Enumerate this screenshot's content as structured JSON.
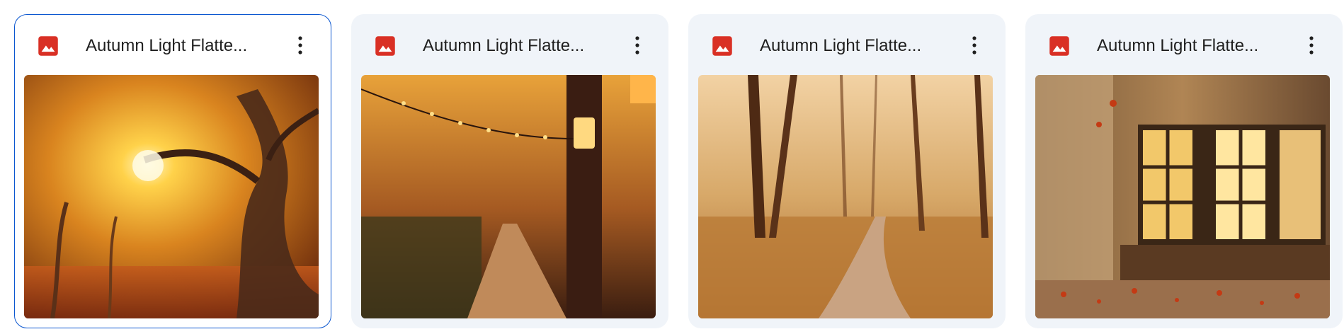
{
  "files": [
    {
      "title": "Autumn Light Flatte...",
      "icon": "image-file-icon",
      "more_icon": "more-vert-icon",
      "selected": true
    },
    {
      "title": "Autumn Light Flatte...",
      "icon": "image-file-icon",
      "more_icon": "more-vert-icon",
      "selected": false
    },
    {
      "title": "Autumn Light Flatte...",
      "icon": "image-file-icon",
      "more_icon": "more-vert-icon",
      "selected": false
    },
    {
      "title": "Autumn Light Flatte...",
      "icon": "image-file-icon",
      "more_icon": "more-vert-icon",
      "selected": false
    }
  ],
  "colors": {
    "icon_red": "#d93025",
    "selected_border": "#0b57d0",
    "card_bg": "#f0f4f9"
  }
}
